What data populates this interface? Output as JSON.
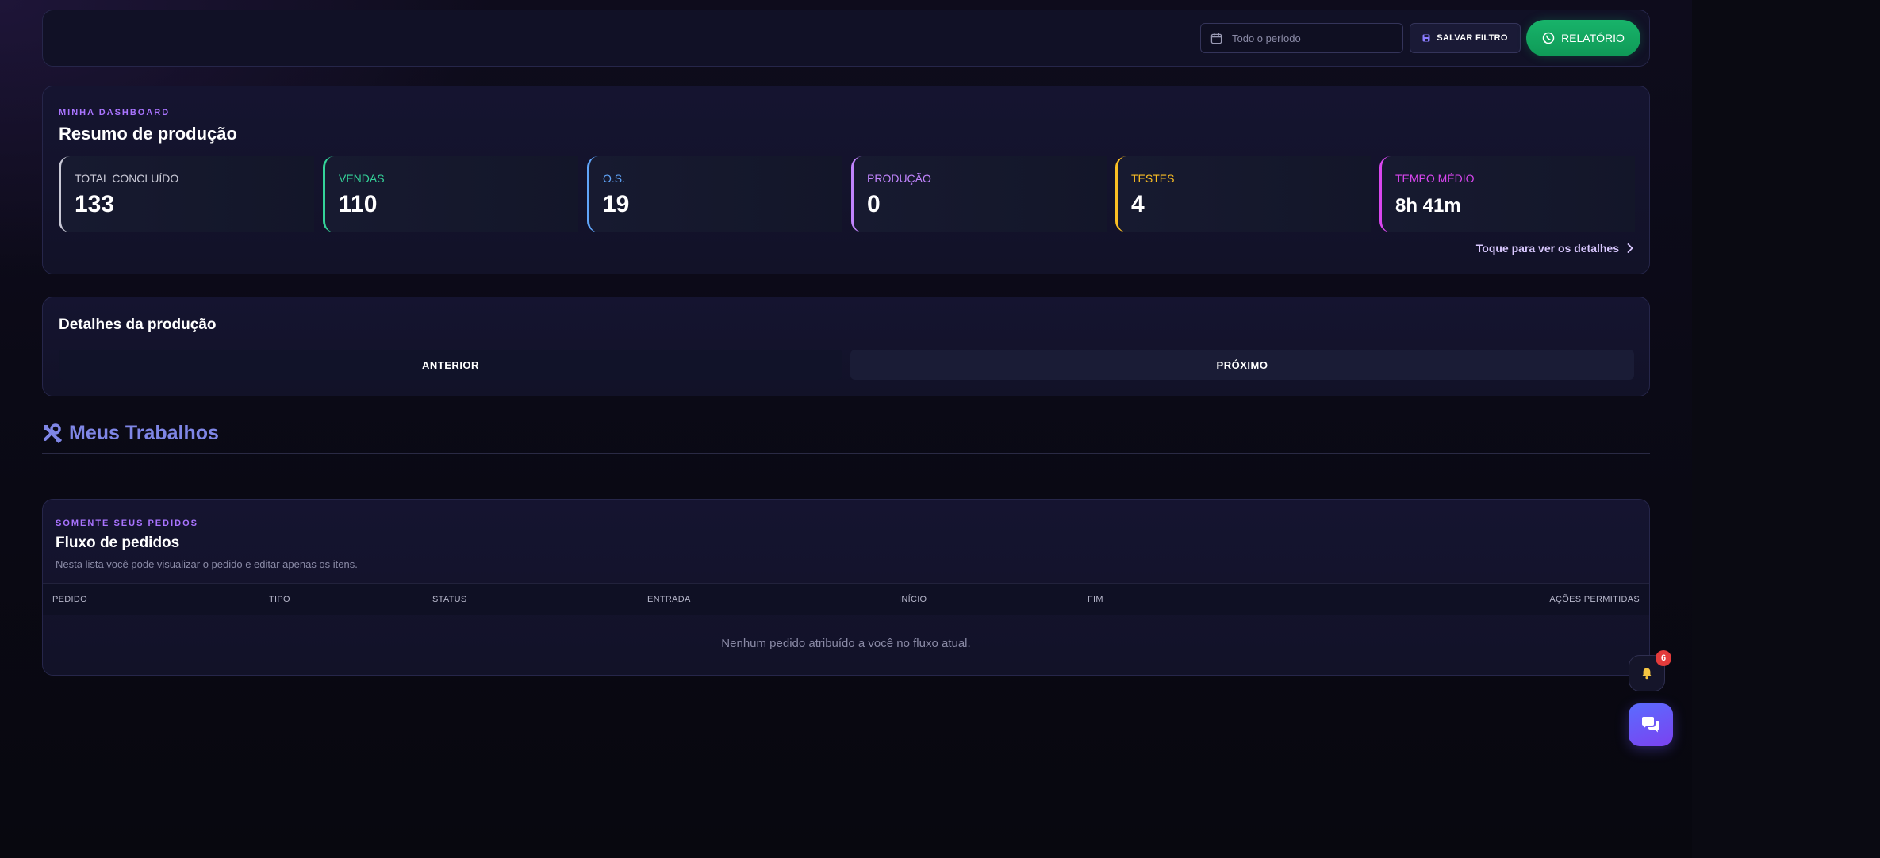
{
  "filter": {
    "period_placeholder": "Todo o período",
    "save_label": "SALVAR FILTRO",
    "report_label": "RELATÓRIO"
  },
  "summary": {
    "eyebrow": "MINHA DASHBOARD",
    "title": "Resumo de produção",
    "stats": [
      {
        "label": "TOTAL CONCLUÍDO",
        "value": "133",
        "color": "#c9c9d6"
      },
      {
        "label": "VENDAS",
        "value": "110",
        "color": "#34d399"
      },
      {
        "label": "O.S.",
        "value": "19",
        "color": "#60a5fa"
      },
      {
        "label": "PRODUÇÃO",
        "value": "0",
        "color": "#c084fc"
      },
      {
        "label": "TESTES",
        "value": "4",
        "color": "#fbbf24"
      },
      {
        "label": "TEMPO MÉDIO",
        "value": "8h 41m",
        "color": "#d946ef"
      }
    ],
    "details_link": "Toque para ver os detalhes"
  },
  "details": {
    "title": "Detalhes da produção",
    "prev_label": "ANTERIOR",
    "next_label": "PRÓXIMO"
  },
  "jobs": {
    "heading": "Meus Trabalhos"
  },
  "orders": {
    "eyebrow": "SOMENTE SEUS PEDIDOS",
    "title": "Fluxo de pedidos",
    "subtitle": "Nesta lista você pode visualizar o pedido e editar apenas os itens.",
    "columns": [
      "PEDIDO",
      "TIPO",
      "STATUS",
      "ENTRADA",
      "INÍCIO",
      "FIM",
      "AÇÕES PERMITIDAS"
    ],
    "empty_message": "Nenhum pedido atribuído a você no fluxo atual."
  },
  "notifications": {
    "count": "6"
  },
  "icons": {
    "calendar": "calendar-icon",
    "save": "floppy-disk-icon",
    "whatsapp": "whatsapp-icon",
    "chevron": "chevron-right-icon",
    "tools": "tools-icon",
    "bell": "bell-icon",
    "chat": "chat-bubbles-icon"
  }
}
